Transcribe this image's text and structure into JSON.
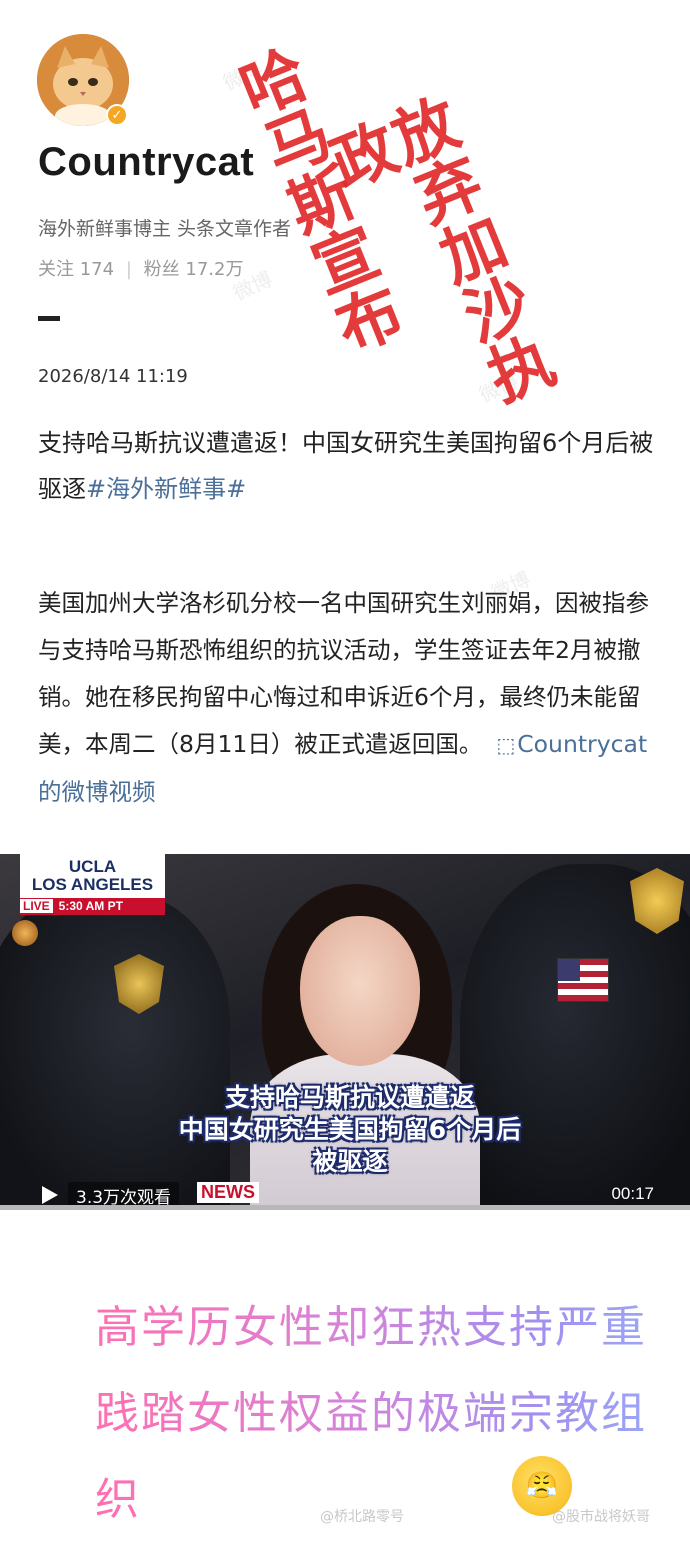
{
  "profile": {
    "username": "Countrycat",
    "description": "海外新鲜事博主 头条文章作者",
    "following_label": "关注",
    "following_count": "174",
    "followers_label": "粉丝",
    "followers_count": "17.2万",
    "verified_icon": "check-icon"
  },
  "post": {
    "timestamp": "2026/8/14 11:19",
    "title": "支持哈马斯抗议遭遣返！中国女研究生美国拘留6个月后被驱逐",
    "topic": "#海外新鲜事#",
    "body": "美国加州大学洛杉矶分校一名中国研究生刘丽娟，因被指参与支持哈马斯恐怖组织的抗议活动，学生签证去年2月被撤销。她在移民拘留中心悔过和申诉近6个月，最终仍未能留美，本周二（8月11日）被正式遣返回国。",
    "video_link": "Countrycat的微博视频"
  },
  "video": {
    "news_label_line1": "UCLA",
    "news_label_line2": "LOS ANGELES",
    "live_text": "LIVE",
    "live_time": "5:30 AM PT",
    "subtitle_line1": "支持哈马斯抗议遭遣返",
    "subtitle_line2": "中国女研究生美国拘留6个月后",
    "subtitle_line3": "被驱逐",
    "news_logo": "NEWS",
    "views": "3.3万次观看",
    "duration": "00:17"
  },
  "stamp": {
    "line1": "哈马斯宣布",
    "line2": "放弃加沙执政"
  },
  "comment": {
    "text": "高学历女性却狂热支持严重践踏女性权益的极端宗教组织",
    "emoji": "😤"
  },
  "watermarks": {
    "bottom_left": "@桥北路零号",
    "bottom_right": "@股市战将妖哥",
    "weibo": "微博"
  }
}
